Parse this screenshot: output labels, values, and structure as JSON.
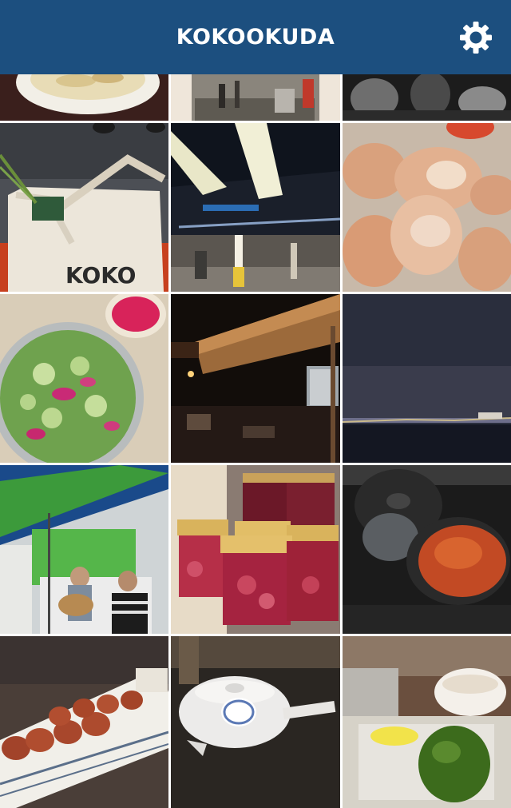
{
  "navbar": {
    "title": "KOKOOKUDA",
    "settings_icon": "gear-icon",
    "background": "#1c4f7f"
  },
  "photos": [
    {
      "id": "soup-bowl-photo"
    },
    {
      "id": "market-hall-photo"
    },
    {
      "id": "black-white-crowd-photo"
    },
    {
      "id": "tote-bag-photo",
      "visible_text": "KOKO"
    },
    {
      "id": "fish-market-interior-photo"
    },
    {
      "id": "fried-chicken-photo"
    },
    {
      "id": "cucumber-salad-photo"
    },
    {
      "id": "night-terrace-photo"
    },
    {
      "id": "night-harbor-photo"
    },
    {
      "id": "street-musician-photo"
    },
    {
      "id": "jam-jars-photo"
    },
    {
      "id": "cast-iron-pot-photo"
    },
    {
      "id": "yakitori-skewers-photo"
    },
    {
      "id": "teapot-photo"
    },
    {
      "id": "avocado-coffee-photo"
    }
  ]
}
